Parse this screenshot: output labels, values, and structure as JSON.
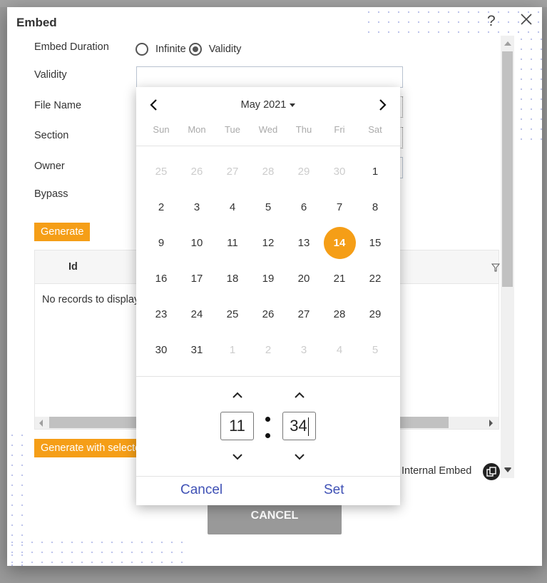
{
  "dialog": {
    "title": "Embed",
    "help_glyph": "?",
    "icons": {
      "help": "question-icon",
      "close": "close-icon"
    }
  },
  "form": {
    "embed_duration_label": "Embed Duration",
    "duration_options": [
      {
        "label": "Infinite",
        "selected": false
      },
      {
        "label": "Validity",
        "selected": true
      }
    ],
    "validity_label": "Validity",
    "validity_value": "",
    "file_name_label": "File Name",
    "section_label": "Section",
    "owner_label": "Owner",
    "bypass_label": "Bypass",
    "generate_button": "Generate"
  },
  "grid": {
    "columns": [
      "Id"
    ],
    "empty_text": "No records to display",
    "filter_icon": "filter-icon"
  },
  "footer": {
    "generate_selected_button": "Generate with selected",
    "internal_embed_label": "Internal Embed",
    "cancel_button": "CANCEL"
  },
  "datepicker": {
    "month_label": "May 2021",
    "weekdays": [
      "Sun",
      "Mon",
      "Tue",
      "Wed",
      "Thu",
      "Fri",
      "Sat"
    ],
    "weeks": [
      [
        {
          "d": "25",
          "m": true
        },
        {
          "d": "26",
          "m": true
        },
        {
          "d": "27",
          "m": true
        },
        {
          "d": "28",
          "m": true
        },
        {
          "d": "29",
          "m": true
        },
        {
          "d": "30",
          "m": true
        },
        {
          "d": "1"
        }
      ],
      [
        {
          "d": "2"
        },
        {
          "d": "3"
        },
        {
          "d": "4"
        },
        {
          "d": "5"
        },
        {
          "d": "6"
        },
        {
          "d": "7"
        },
        {
          "d": "8"
        }
      ],
      [
        {
          "d": "9"
        },
        {
          "d": "10"
        },
        {
          "d": "11"
        },
        {
          "d": "12"
        },
        {
          "d": "13"
        },
        {
          "d": "14",
          "s": true
        },
        {
          "d": "15"
        }
      ],
      [
        {
          "d": "16"
        },
        {
          "d": "17"
        },
        {
          "d": "18"
        },
        {
          "d": "19"
        },
        {
          "d": "20"
        },
        {
          "d": "21"
        },
        {
          "d": "22"
        }
      ],
      [
        {
          "d": "23"
        },
        {
          "d": "24"
        },
        {
          "d": "25"
        },
        {
          "d": "26"
        },
        {
          "d": "27"
        },
        {
          "d": "28"
        },
        {
          "d": "29"
        }
      ],
      [
        {
          "d": "30"
        },
        {
          "d": "31"
        },
        {
          "d": "1",
          "m": true
        },
        {
          "d": "2",
          "m": true
        },
        {
          "d": "3",
          "m": true
        },
        {
          "d": "4",
          "m": true
        },
        {
          "d": "5",
          "m": true
        }
      ]
    ],
    "selected_day": "14",
    "hour": "11",
    "minute": "34",
    "cancel_label": "Cancel",
    "set_label": "Set"
  },
  "colors": {
    "accent": "#f59e17",
    "link": "#3f51b5",
    "cancel_button_bg": "#999999"
  }
}
